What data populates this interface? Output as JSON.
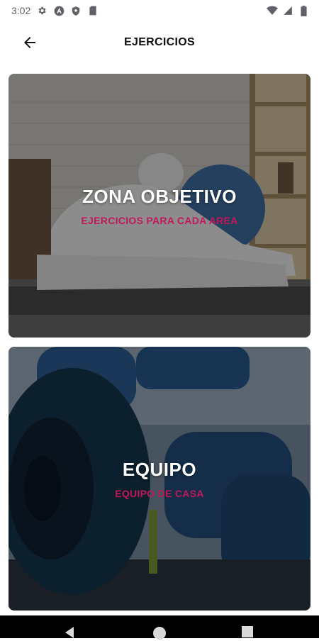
{
  "status_bar": {
    "time": "3:02",
    "icons": [
      "settings-icon",
      "a-icon",
      "shield-icon",
      "sd-card-icon",
      "wifi-icon",
      "signal-icon",
      "battery-icon"
    ]
  },
  "header": {
    "back_icon": "arrow-back-icon",
    "title": "EJERCICIOS"
  },
  "cards": [
    {
      "title": "ZONA OBJETIVO",
      "subtitle": "EJERCICIOS PARA CADA AREA",
      "image": "stretching-woman-photo"
    },
    {
      "title": "EQUIPO",
      "subtitle": "EQUIPO DE CASA",
      "image": "yoga-mat-dumbbells-photo"
    }
  ],
  "colors": {
    "accent": "#c2185b",
    "status_text": "#5f6368",
    "title_text": "#111111"
  },
  "nav_bar": {
    "buttons": [
      "back-nav-icon",
      "home-nav-icon",
      "recents-nav-icon"
    ]
  }
}
